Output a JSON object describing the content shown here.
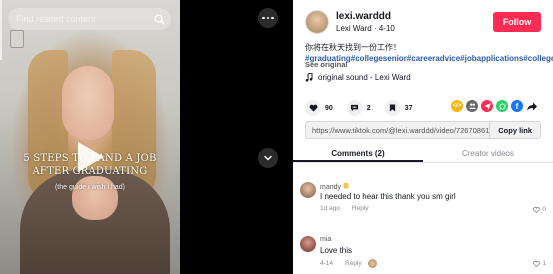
{
  "video": {
    "search_placeholder": "Find related content",
    "overlay_title": "5 STEPS TO LAND A JOB\nAFTER GRADUATING",
    "overlay_subtitle": "(the guide i wish i had)"
  },
  "author": {
    "username": "lexi.warddd",
    "display_name": "Lexi Ward",
    "date": "4-10",
    "follow_label": "Follow"
  },
  "description": {
    "text": "你将在秋天找到一份工作！",
    "hashtags": "#graduating#collegesenior#careeradvice#jobapplications#collegeadvice",
    "see_original": "See original",
    "sound": "original sound - Lexi Ward"
  },
  "stats": {
    "likes": "90",
    "comments": "2",
    "saves": "37"
  },
  "share_icons": [
    "embed-icon",
    "friends-icon",
    "send-icon",
    "whatsapp-icon",
    "facebook-icon",
    "share-arrow-icon"
  ],
  "colors": {
    "follow": "#fe2c55",
    "hashtag": "#2b5db9",
    "embed": "#f6b50f",
    "friends": "#6a6a6a",
    "send": "#fe2c55",
    "whatsapp": "#25d366",
    "facebook": "#1877f2"
  },
  "link": {
    "url": "https://www.tiktok.com/@lexi.warddd/video/72670861...",
    "copy_label": "Copy link"
  },
  "tabs": [
    {
      "label": "Comments (2)",
      "active": true
    },
    {
      "label": "Creator videos",
      "active": false
    }
  ],
  "comments": [
    {
      "user": "mandy",
      "text": "I needed to hear this thank you sm girl",
      "time": "1d ago",
      "reply": "Reply",
      "likes": "0"
    },
    {
      "user": "mia",
      "text": "Love this",
      "time": "4-14",
      "reply": "Reply",
      "likes": "1"
    }
  ]
}
